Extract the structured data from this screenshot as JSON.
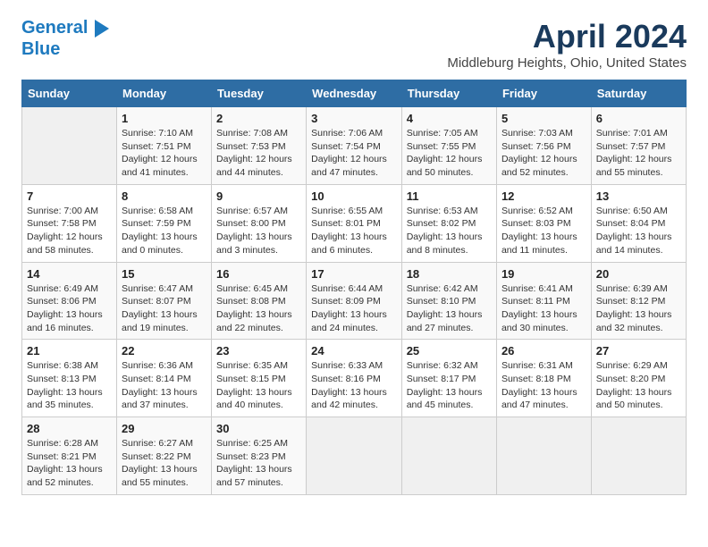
{
  "header": {
    "logo_line1": "General",
    "logo_line2": "Blue",
    "month": "April 2024",
    "location": "Middleburg Heights, Ohio, United States"
  },
  "weekdays": [
    "Sunday",
    "Monday",
    "Tuesday",
    "Wednesday",
    "Thursday",
    "Friday",
    "Saturday"
  ],
  "weeks": [
    [
      {
        "day": "",
        "info": ""
      },
      {
        "day": "1",
        "info": "Sunrise: 7:10 AM\nSunset: 7:51 PM\nDaylight: 12 hours\nand 41 minutes."
      },
      {
        "day": "2",
        "info": "Sunrise: 7:08 AM\nSunset: 7:53 PM\nDaylight: 12 hours\nand 44 minutes."
      },
      {
        "day": "3",
        "info": "Sunrise: 7:06 AM\nSunset: 7:54 PM\nDaylight: 12 hours\nand 47 minutes."
      },
      {
        "day": "4",
        "info": "Sunrise: 7:05 AM\nSunset: 7:55 PM\nDaylight: 12 hours\nand 50 minutes."
      },
      {
        "day": "5",
        "info": "Sunrise: 7:03 AM\nSunset: 7:56 PM\nDaylight: 12 hours\nand 52 minutes."
      },
      {
        "day": "6",
        "info": "Sunrise: 7:01 AM\nSunset: 7:57 PM\nDaylight: 12 hours\nand 55 minutes."
      }
    ],
    [
      {
        "day": "7",
        "info": "Sunrise: 7:00 AM\nSunset: 7:58 PM\nDaylight: 12 hours\nand 58 minutes."
      },
      {
        "day": "8",
        "info": "Sunrise: 6:58 AM\nSunset: 7:59 PM\nDaylight: 13 hours\nand 0 minutes."
      },
      {
        "day": "9",
        "info": "Sunrise: 6:57 AM\nSunset: 8:00 PM\nDaylight: 13 hours\nand 3 minutes."
      },
      {
        "day": "10",
        "info": "Sunrise: 6:55 AM\nSunset: 8:01 PM\nDaylight: 13 hours\nand 6 minutes."
      },
      {
        "day": "11",
        "info": "Sunrise: 6:53 AM\nSunset: 8:02 PM\nDaylight: 13 hours\nand 8 minutes."
      },
      {
        "day": "12",
        "info": "Sunrise: 6:52 AM\nSunset: 8:03 PM\nDaylight: 13 hours\nand 11 minutes."
      },
      {
        "day": "13",
        "info": "Sunrise: 6:50 AM\nSunset: 8:04 PM\nDaylight: 13 hours\nand 14 minutes."
      }
    ],
    [
      {
        "day": "14",
        "info": "Sunrise: 6:49 AM\nSunset: 8:06 PM\nDaylight: 13 hours\nand 16 minutes."
      },
      {
        "day": "15",
        "info": "Sunrise: 6:47 AM\nSunset: 8:07 PM\nDaylight: 13 hours\nand 19 minutes."
      },
      {
        "day": "16",
        "info": "Sunrise: 6:45 AM\nSunset: 8:08 PM\nDaylight: 13 hours\nand 22 minutes."
      },
      {
        "day": "17",
        "info": "Sunrise: 6:44 AM\nSunset: 8:09 PM\nDaylight: 13 hours\nand 24 minutes."
      },
      {
        "day": "18",
        "info": "Sunrise: 6:42 AM\nSunset: 8:10 PM\nDaylight: 13 hours\nand 27 minutes."
      },
      {
        "day": "19",
        "info": "Sunrise: 6:41 AM\nSunset: 8:11 PM\nDaylight: 13 hours\nand 30 minutes."
      },
      {
        "day": "20",
        "info": "Sunrise: 6:39 AM\nSunset: 8:12 PM\nDaylight: 13 hours\nand 32 minutes."
      }
    ],
    [
      {
        "day": "21",
        "info": "Sunrise: 6:38 AM\nSunset: 8:13 PM\nDaylight: 13 hours\nand 35 minutes."
      },
      {
        "day": "22",
        "info": "Sunrise: 6:36 AM\nSunset: 8:14 PM\nDaylight: 13 hours\nand 37 minutes."
      },
      {
        "day": "23",
        "info": "Sunrise: 6:35 AM\nSunset: 8:15 PM\nDaylight: 13 hours\nand 40 minutes."
      },
      {
        "day": "24",
        "info": "Sunrise: 6:33 AM\nSunset: 8:16 PM\nDaylight: 13 hours\nand 42 minutes."
      },
      {
        "day": "25",
        "info": "Sunrise: 6:32 AM\nSunset: 8:17 PM\nDaylight: 13 hours\nand 45 minutes."
      },
      {
        "day": "26",
        "info": "Sunrise: 6:31 AM\nSunset: 8:18 PM\nDaylight: 13 hours\nand 47 minutes."
      },
      {
        "day": "27",
        "info": "Sunrise: 6:29 AM\nSunset: 8:20 PM\nDaylight: 13 hours\nand 50 minutes."
      }
    ],
    [
      {
        "day": "28",
        "info": "Sunrise: 6:28 AM\nSunset: 8:21 PM\nDaylight: 13 hours\nand 52 minutes."
      },
      {
        "day": "29",
        "info": "Sunrise: 6:27 AM\nSunset: 8:22 PM\nDaylight: 13 hours\nand 55 minutes."
      },
      {
        "day": "30",
        "info": "Sunrise: 6:25 AM\nSunset: 8:23 PM\nDaylight: 13 hours\nand 57 minutes."
      },
      {
        "day": "",
        "info": ""
      },
      {
        "day": "",
        "info": ""
      },
      {
        "day": "",
        "info": ""
      },
      {
        "day": "",
        "info": ""
      }
    ]
  ]
}
